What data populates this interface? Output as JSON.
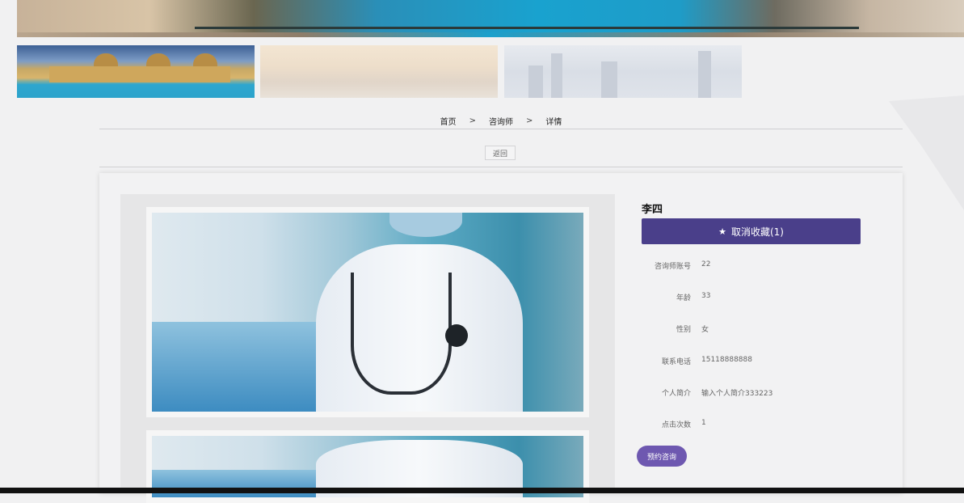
{
  "breadcrumb": {
    "home": "首页",
    "separator": ">",
    "list": "咨询师",
    "current": "详情"
  },
  "back": {
    "label": "返回"
  },
  "counselor": {
    "name": "李四",
    "favorite_label": "取消收藏(1)",
    "favorite_icon": "star-icon"
  },
  "details": [
    {
      "label": "咨询师账号",
      "value": "22"
    },
    {
      "label": "年龄",
      "value": "33"
    },
    {
      "label": "性别",
      "value": "女"
    },
    {
      "label": "联系电话",
      "value": "15118888888"
    },
    {
      "label": "个人简介",
      "value": "输入个人简介333223"
    },
    {
      "label": "点击次数",
      "value": "1"
    }
  ],
  "consult": {
    "label": "预约咨询"
  },
  "colors": {
    "primary": "#4a3f8a",
    "consult": "#6e58b0",
    "background": "#f1f1f2"
  }
}
